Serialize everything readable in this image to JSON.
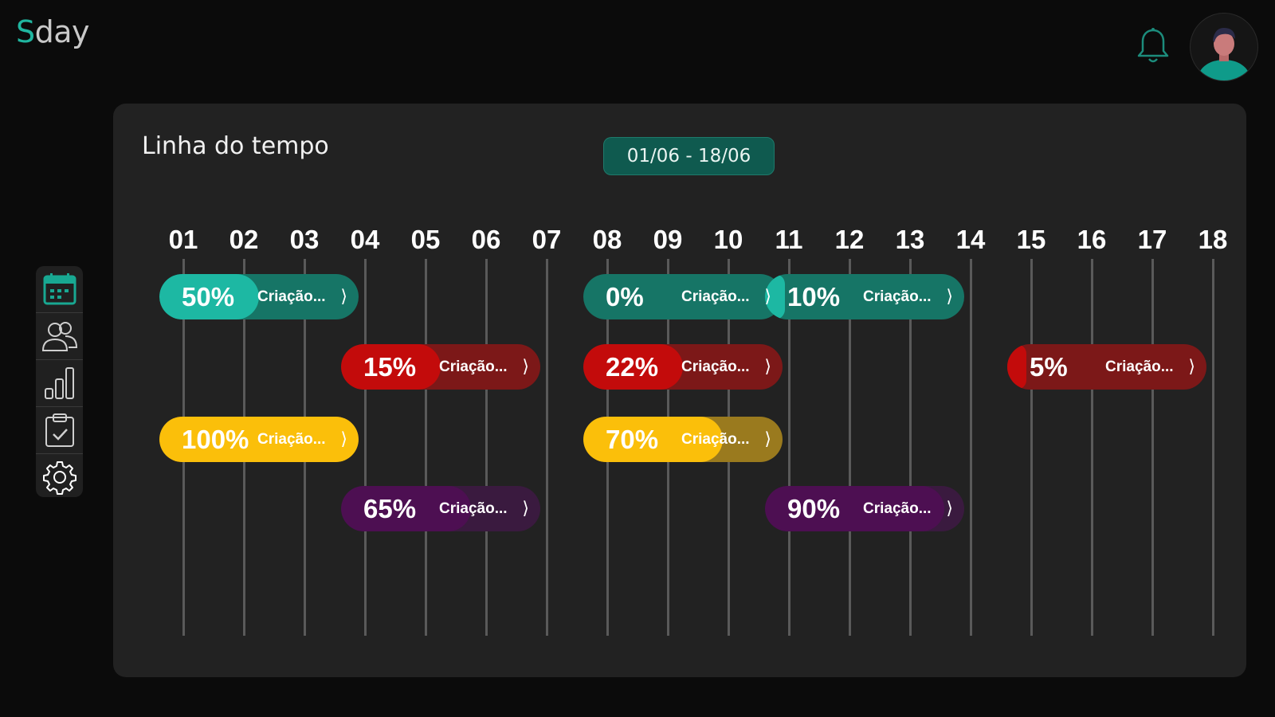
{
  "app": {
    "logo_initial": "S",
    "logo_rest": "day"
  },
  "header": {
    "notifications_icon": "bell-icon",
    "avatar_icon": "user-avatar-icon"
  },
  "sidebar": {
    "items": [
      {
        "icon": "calendar-icon",
        "active": true
      },
      {
        "icon": "users-icon",
        "active": false
      },
      {
        "icon": "bar-chart-icon",
        "active": false
      },
      {
        "icon": "clipboard-check-icon",
        "active": false
      },
      {
        "icon": "gear-icon",
        "active": false
      }
    ]
  },
  "timeline": {
    "title": "Linha do tempo",
    "date_range": "01/06 - 18/06",
    "days": [
      "01",
      "02",
      "03",
      "04",
      "05",
      "06",
      "07",
      "08",
      "09",
      "10",
      "11",
      "12",
      "13",
      "14",
      "15",
      "16",
      "17",
      "18"
    ],
    "tasks": [
      {
        "percent": "50%",
        "progress": 0.5,
        "label": "Criação...",
        "color": "#1db8a3",
        "track": "#167566",
        "start_day": "01",
        "row": 0
      },
      {
        "percent": "0%",
        "progress": 0.0,
        "label": "Criação...",
        "color": "#1db8a3",
        "track": "#167566",
        "start_day": "08",
        "row": 0
      },
      {
        "percent": "10%",
        "progress": 0.1,
        "label": "Criação...",
        "color": "#1db8a3",
        "track": "#167566",
        "start_day": "11",
        "row": 0
      },
      {
        "percent": "15%",
        "progress": 0.5,
        "label": "Criação...",
        "color": "#c30b0b",
        "track": "#7c1818",
        "start_day": "04",
        "row": 1
      },
      {
        "percent": "22%",
        "progress": 0.5,
        "label": "Criação...",
        "color": "#c30b0b",
        "track": "#7c1818",
        "start_day": "08",
        "row": 1
      },
      {
        "percent": "5%",
        "progress": 0.05,
        "label": "Criação...",
        "color": "#c30b0b",
        "track": "#7c1818",
        "start_day": "15",
        "row": 1
      },
      {
        "percent": "100%",
        "progress": 1.0,
        "label": "Criação...",
        "color": "#fbbf0a",
        "track": "#9a7a1e",
        "start_day": "01",
        "row": 2
      },
      {
        "percent": "70%",
        "progress": 0.7,
        "label": "Criação...",
        "color": "#fbbf0a",
        "track": "#9a7a1e",
        "start_day": "08",
        "row": 2
      },
      {
        "percent": "65%",
        "progress": 0.65,
        "label": "Criação...",
        "color": "#4d0f52",
        "track": "#3a1a3f",
        "start_day": "04",
        "row": 3
      },
      {
        "percent": "90%",
        "progress": 0.9,
        "label": "Criação...",
        "color": "#4d0f52",
        "track": "#3a1a3f",
        "start_day": "11",
        "row": 3
      }
    ]
  }
}
